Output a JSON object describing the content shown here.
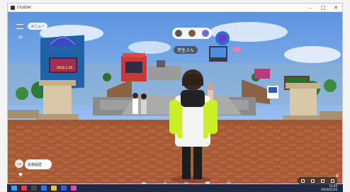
{
  "app": {
    "title": "cluster"
  },
  "window_controls": {
    "minimize": "–",
    "maximize": "□",
    "close": "✕"
  },
  "menu_pill": {
    "label": "メニュー"
  },
  "player": {
    "nametag": "学生さん"
  },
  "chat": {
    "pill_label": "投稿履歴"
  },
  "billboard": {
    "text": "2024.1.26"
  },
  "taskbar": {
    "time": "14:05",
    "date": "2024/01/26"
  },
  "colors": {
    "sky": "#7fb4ef",
    "floor": "#b5653e",
    "taskbar": "#1f2a44",
    "jacket_lime": "#c9ef26"
  }
}
